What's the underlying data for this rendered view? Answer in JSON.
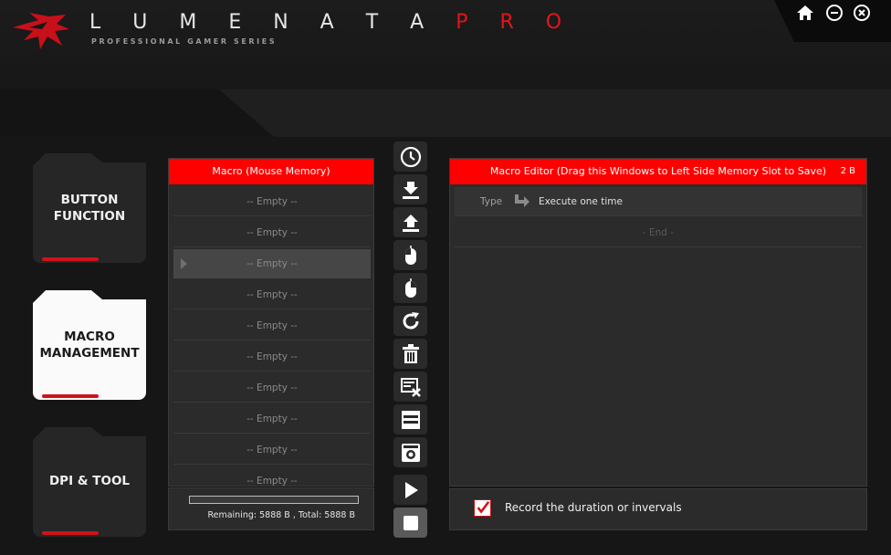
{
  "header": {
    "brand_main": "L U M E N A T A",
    "brand_pro": "P R O",
    "subtitle": "PROFESSIONAL GAMER SERIES"
  },
  "window_controls": [
    "home-icon",
    "minimize-icon",
    "close-icon"
  ],
  "nav": {
    "items": [
      {
        "line1": "BUTTON",
        "line2": "FUNCTION",
        "active": false
      },
      {
        "line1": "MACRO",
        "line2": "MANAGEMENT",
        "active": true
      },
      {
        "line1": "DPI & TOOL",
        "line2": "",
        "active": false
      }
    ]
  },
  "macro_list": {
    "title": "Macro (Mouse Memory)",
    "slots": [
      "-- Empty --",
      "-- Empty --",
      "-- Empty --",
      "-- Empty --",
      "-- Empty --",
      "-- Empty --",
      "-- Empty --",
      "-- Empty --",
      "-- Empty --",
      "-- Empty --"
    ],
    "selected_index": 2,
    "memory_text": "Remaining: 5888 B , Total: 5888 B"
  },
  "toolbar": {
    "icons": [
      "clock-icon",
      "download-icon",
      "upload-icon",
      "mouse-left-icon",
      "mouse-right-icon",
      "refresh-icon",
      "trash-icon",
      "clear-list-icon",
      "record-list-icon",
      "screen-record-icon",
      "play-icon",
      "stop-icon"
    ]
  },
  "editor": {
    "title": "Macro Editor (Drag this Windows to Left Side Memory Slot to Save)",
    "size": "2 B",
    "type_label": "Type",
    "type_value": "Execute one time",
    "end_label": "- End -"
  },
  "record": {
    "label": "Record the duration or invervals",
    "checked": true
  },
  "colors": {
    "accent": "#ff0000",
    "background": "#161616",
    "panel": "#2b2b2b"
  }
}
